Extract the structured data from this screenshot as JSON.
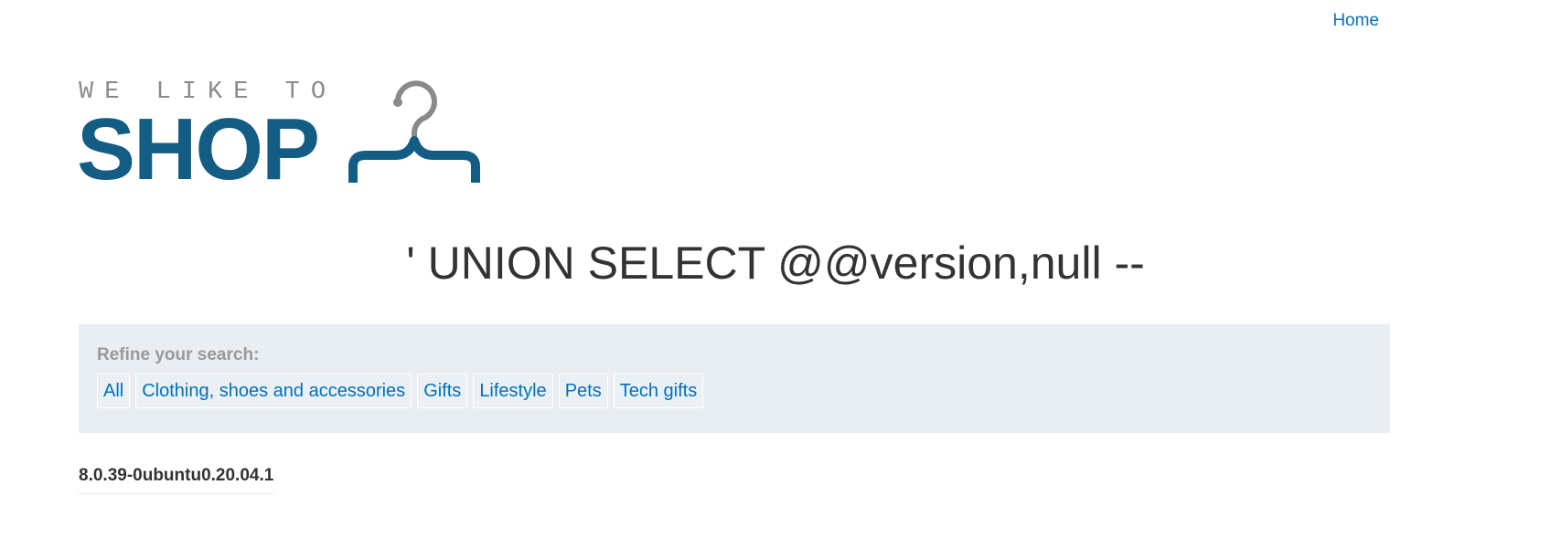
{
  "nav": {
    "home_label": "Home"
  },
  "logo": {
    "tagline": "WE LIKE TO",
    "word": "SHOP"
  },
  "heading": "' UNION SELECT @@version,null --",
  "filter": {
    "title": "Refine your search:",
    "tags": [
      "All",
      "Clothing, shoes and accessories",
      "Gifts",
      "Lifestyle",
      "Pets",
      "Tech gifts"
    ]
  },
  "results": [
    {
      "value": "8.0.39-0ubuntu0.20.04.1"
    }
  ],
  "colors": {
    "link": "#0071bc",
    "brand": "#135c84",
    "panel": "#e8eef1",
    "text": "#333333"
  }
}
